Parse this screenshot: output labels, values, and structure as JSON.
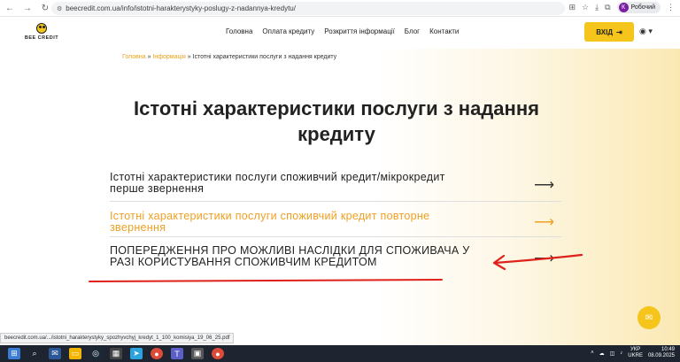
{
  "browser": {
    "url": "beecredit.com.ua/info/istotni-harakterystyky-poslugy-z-nadannya-kredytu/",
    "profile_label": "Робочий",
    "profile_initial": "К"
  },
  "header": {
    "logo_text": "BEE CREDIT",
    "nav": [
      "Головна",
      "Оплата кредиту",
      "Розкриття інформації",
      "Блог",
      "Контакти"
    ],
    "login_label": "ВХІД"
  },
  "breadcrumb": {
    "home": "Головна",
    "sep1": "»",
    "section": "Інформація",
    "sep2": "»",
    "current": "Істотні характеристики послуги з надання кредиту"
  },
  "page": {
    "title_line1": "Істотні характеристики послуги з надання",
    "title_line2": "кредиту"
  },
  "links": [
    {
      "line1": "Істотні характеристики послуги споживчий кредит/мікрокредит",
      "line2": "перше звернення"
    },
    {
      "line1": "Істотні характеристики послуги споживчий кредит повторне",
      "line2": "звернення"
    },
    {
      "line1": "ПОПЕРЕДЖЕННЯ ПРО МОЖЛИВІ НАСЛІДКИ ДЛЯ СПОЖИВАЧА У",
      "line2": "РАЗІ КОРИСТУВАННЯ СПОЖИВЧИМ КРЕДИТОМ"
    }
  ],
  "status_bar_url": "beecredit.com.ua/.../istotni_harakterystyky_spozhyvchyj_kredyt_1_100_komisiya_19_06_25.pdf",
  "taskbar": {
    "lang_top": "УКР",
    "lang_bottom": "UKRE",
    "time": "10:49",
    "date": "08.09.2025"
  },
  "colors": {
    "accent": "#f6c51b",
    "link_active": "#f0a023",
    "annotation_red": "#e0201a"
  }
}
